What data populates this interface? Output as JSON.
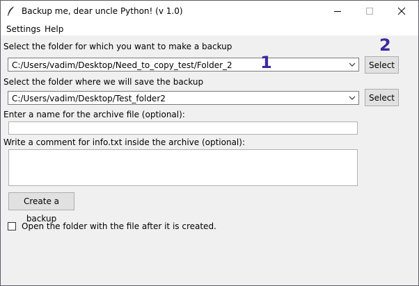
{
  "window": {
    "title": "Backup me, dear uncle Python! (v 1.0)",
    "icon": "feather-icon"
  },
  "menu": {
    "settings": "Settings",
    "help": "Help"
  },
  "source": {
    "label": "Select the folder for which you want to make a backup",
    "value": "C:/Users/vadim/Desktop/Need_to_copy_test/Folder_2",
    "button": "Select"
  },
  "destination": {
    "label": "Select the folder where we will save the backup",
    "value": "C:/Users/vadim/Desktop/Test_folder2",
    "button": "Select"
  },
  "archive_name": {
    "label": "Enter a name for the archive file (optional):",
    "value": ""
  },
  "comment": {
    "label": "Write a comment for info.txt inside the archive (optional):",
    "value": ""
  },
  "create_button": "Create a backup",
  "open_folder": {
    "label": "Open the folder with the file after it is created.",
    "checked": false
  },
  "annotations": {
    "one": "1",
    "two": "2"
  },
  "colors": {
    "annotation": "#3a2ba0"
  }
}
